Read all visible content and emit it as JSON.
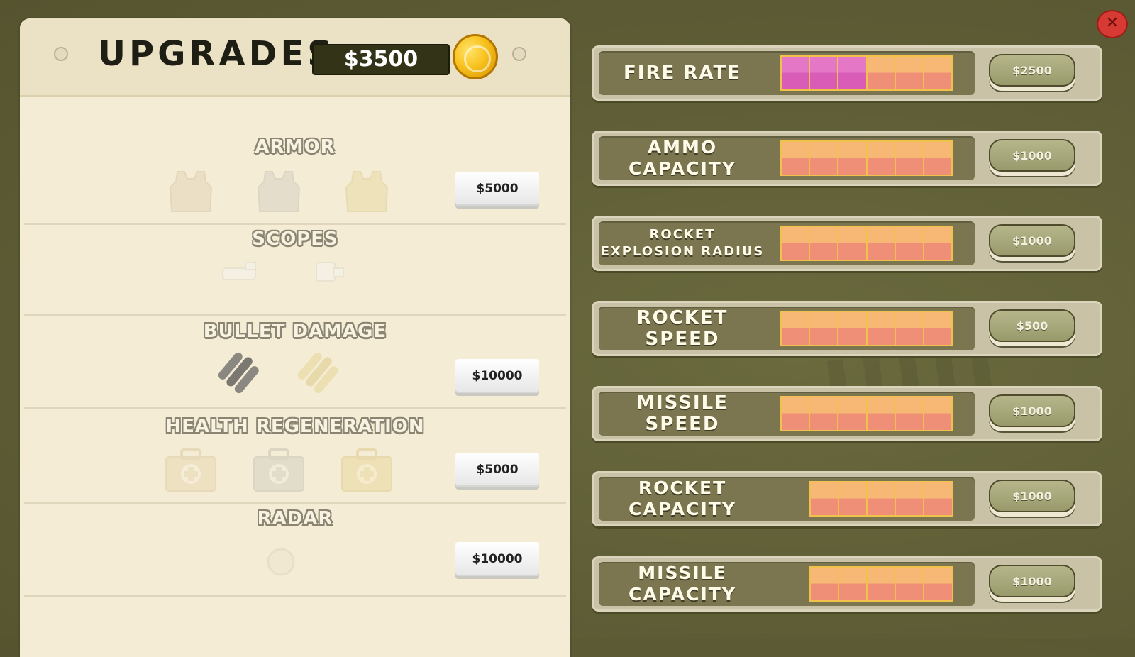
{
  "header": {
    "title": "UPGRADES",
    "money": "$3500"
  },
  "left_sections": [
    {
      "title": "ARMOR",
      "price": "$5000"
    },
    {
      "title": "SCOPES"
    },
    {
      "title": "BULLET DAMAGE",
      "price": "$10000"
    },
    {
      "title": "HEALTH REGENERATION",
      "price": "$5000"
    },
    {
      "title": "RADAR",
      "price": "$10000"
    }
  ],
  "upgrades": [
    {
      "label": "FIRE RATE",
      "price": "$2500",
      "level": 3,
      "max": 6
    },
    {
      "label": "AMMO\nCAPACITY",
      "price": "$1000",
      "level": 0,
      "max": 6
    },
    {
      "label": "ROCKET\nEXPLOSION RADIUS",
      "price": "$1000",
      "level": 0,
      "max": 6
    },
    {
      "label": "ROCKET SPEED",
      "price": "$500",
      "level": 0,
      "max": 6
    },
    {
      "label": "MISSILE\nSPEED",
      "price": "$1000",
      "level": 0,
      "max": 6
    },
    {
      "label": "ROCKET\nCAPACITY",
      "price": "$1000",
      "level": 0,
      "max": 5
    },
    {
      "label": "MISSILE\nCAPACITY",
      "price": "$1000",
      "level": 0,
      "max": 5
    }
  ],
  "colors": {
    "accent_fill": "#d95cb6",
    "empty_fill": "#f1b074",
    "close": "#d63a32"
  },
  "icons": {
    "close": "close-icon",
    "coin": "coin-icon"
  }
}
